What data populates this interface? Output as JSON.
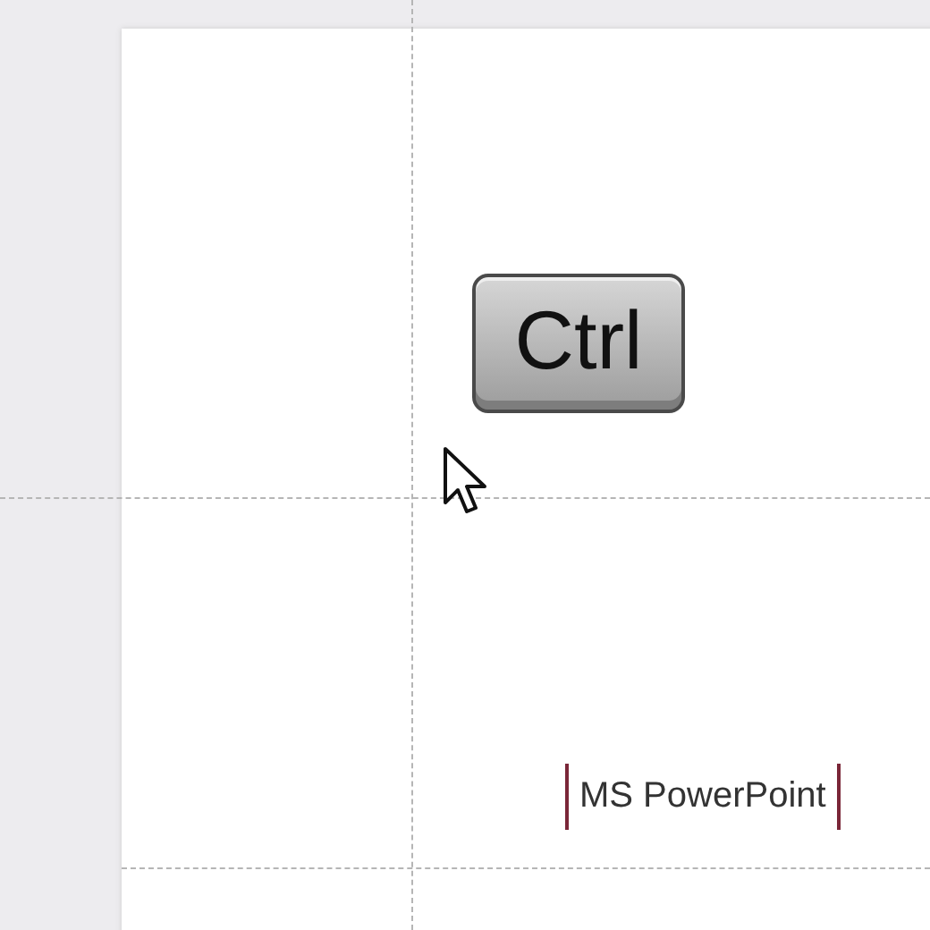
{
  "slide": {
    "key": {
      "label": "Ctrl"
    },
    "caption": "MS PowerPoint"
  }
}
